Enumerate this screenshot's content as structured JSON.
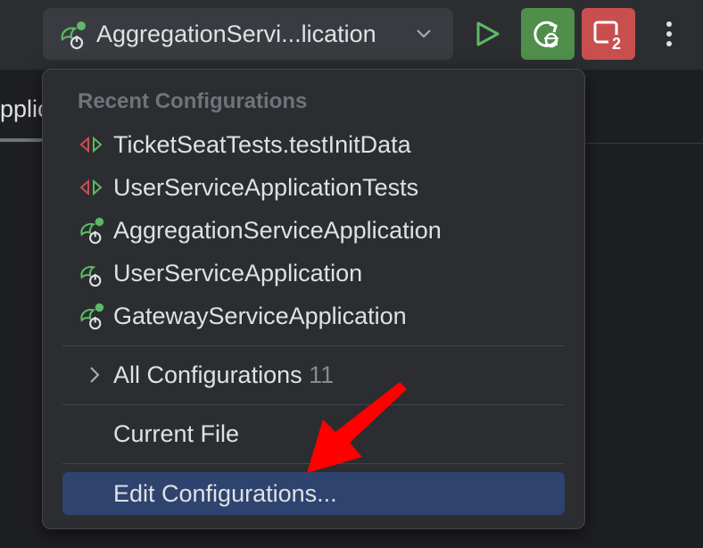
{
  "toolbar": {
    "run_config_title": "AggregationServi...lication",
    "run_config_icon": "spring-boot-running-icon",
    "play_icon": "play-icon",
    "debug_icon": "rerun-debug-icon",
    "stop_icon": "stop-icon",
    "stop_count": "2",
    "more_icon": "more-vertical-icon"
  },
  "editor": {
    "tab_fragment": "Applica"
  },
  "popup": {
    "header": "Recent Configurations",
    "recent": [
      {
        "label": "TicketSeatTests.testInitData",
        "icon": "test-icon"
      },
      {
        "label": "UserServiceApplicationTests",
        "icon": "test-icon"
      },
      {
        "label": "AggregationServiceApplication",
        "icon": "spring-boot-running-icon"
      },
      {
        "label": "UserServiceApplication",
        "icon": "spring-boot-icon"
      },
      {
        "label": "GatewayServiceApplication",
        "icon": "spring-boot-running-icon"
      }
    ],
    "all_configurations": {
      "label": "All Configurations",
      "count": "11",
      "icon": "chevron-right-icon"
    },
    "current_file": "Current File",
    "edit_configurations": "Edit Configurations..."
  },
  "colors": {
    "accent_green": "#4f8f4a",
    "running_dot": "#5fb865",
    "stop_red": "#c94f4f",
    "selection": "#2e436e",
    "annotation_arrow": "#ff0000"
  }
}
